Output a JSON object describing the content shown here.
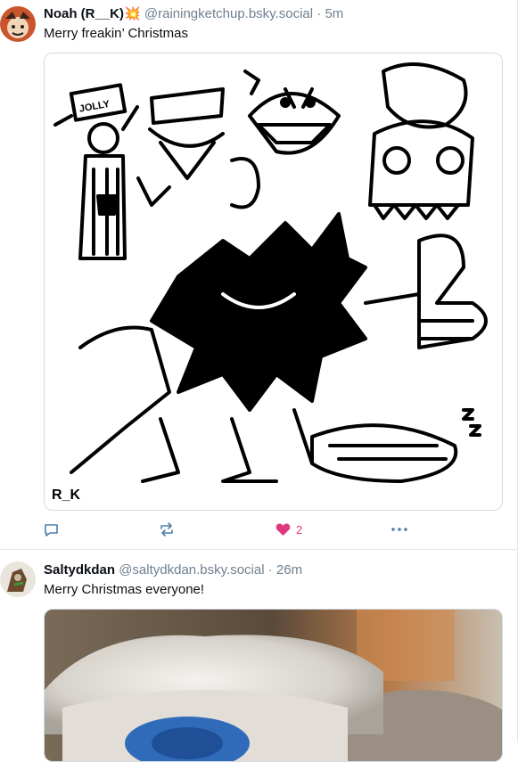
{
  "posts": [
    {
      "display_name": "Noah (R__K)",
      "emoji": "💥",
      "handle": "@rainingketchup.bsky.social",
      "separator": "·",
      "time": "5m",
      "text": "Merry freakin’ Christmas",
      "image_signature": "R_K",
      "image_sign_text": "JOLLY",
      "likes": "2"
    },
    {
      "display_name": "Saltydkdan",
      "handle": "@saltydkdan.bsky.social",
      "separator": "·",
      "time": "26m",
      "text": "Merry Christmas everyone!"
    }
  ],
  "colors": {
    "like_pink": "#e0387e",
    "action_blue": "#4d7ea8",
    "muted": "#6f7f8f"
  }
}
